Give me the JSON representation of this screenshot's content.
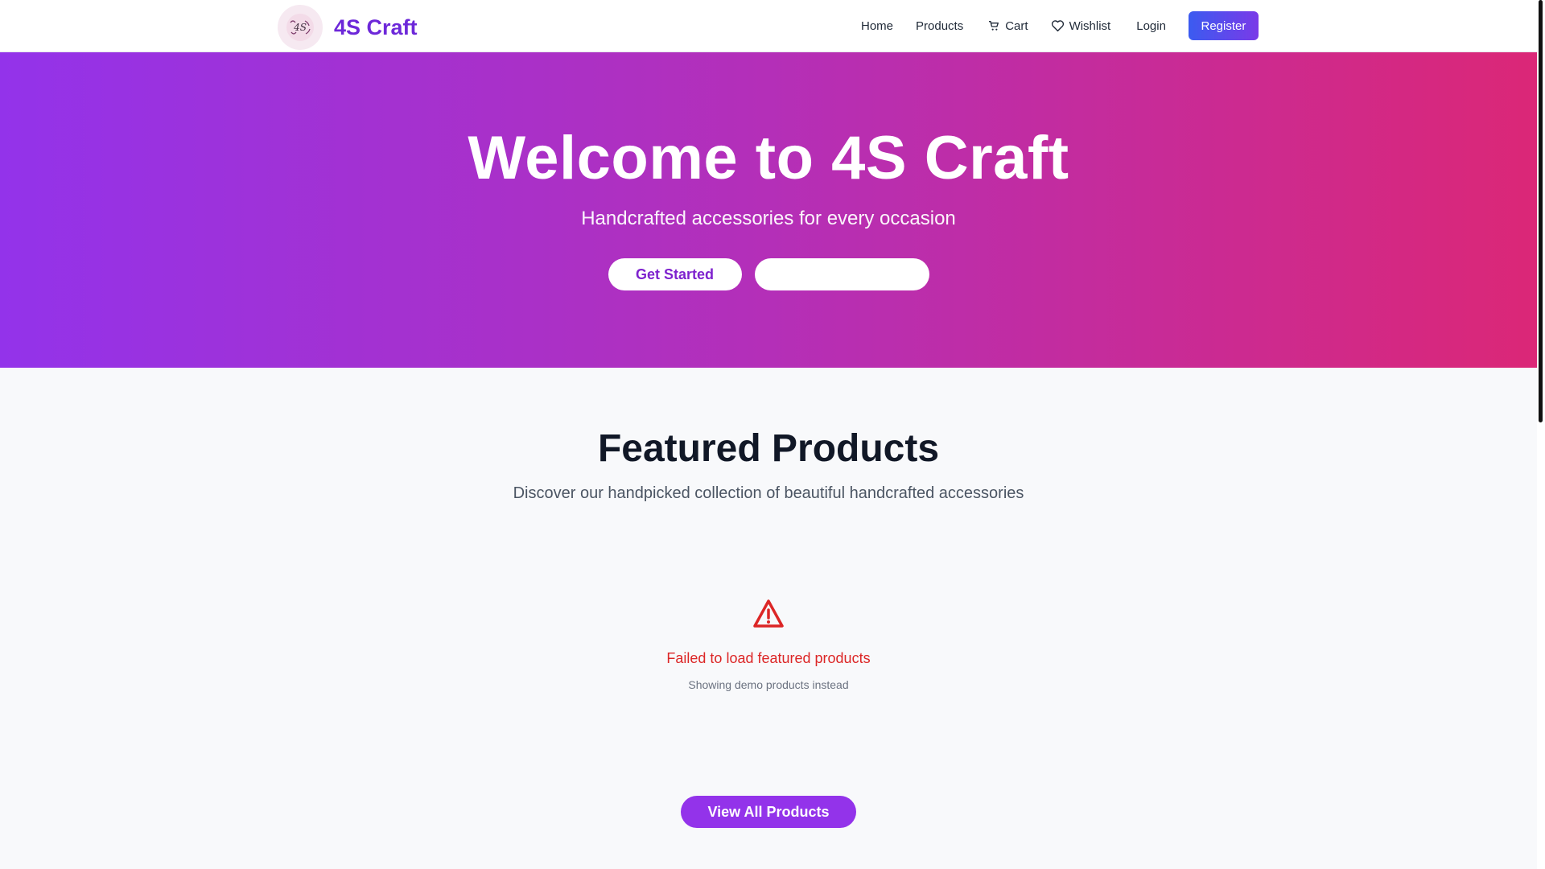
{
  "header": {
    "brand": "4S Craft",
    "logo_text": "4S",
    "nav": {
      "home": "Home",
      "products": "Products",
      "cart": "Cart",
      "wishlist": "Wishlist",
      "login": "Login",
      "register": "Register"
    }
  },
  "hero": {
    "title": "Welcome to 4S Craft",
    "subtitle": "Handcrafted accessories for every occasion",
    "primary_button": "Get Started",
    "secondary_button": ""
  },
  "featured": {
    "title": "Featured Products",
    "subtitle": "Discover our handpicked collection of beautiful handcrafted accessories",
    "error_icon": "warning-triangle-icon",
    "error_message": "Failed to load featured products",
    "error_note": "Showing demo products instead",
    "view_all": "View All Products"
  },
  "colors": {
    "brand": "#6d28d9",
    "hero_gradient_start": "#9333ea",
    "hero_gradient_end": "#db2777",
    "error": "#dc2626"
  },
  "icons": {
    "cart": "cart-icon",
    "wishlist": "heart-icon"
  }
}
